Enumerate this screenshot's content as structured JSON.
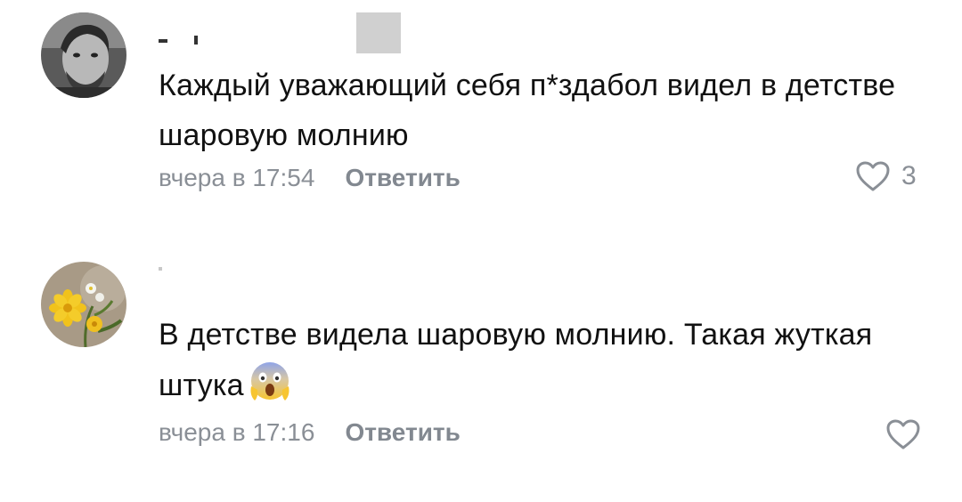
{
  "comments": [
    {
      "author": "",
      "text": "Каждый уважающий себя п*здабол видел в детстве шаровую молнию",
      "time": "вчера в 17:54",
      "reply_label": "Ответить",
      "likes": "3",
      "avatar": "man-portrait-avatar"
    },
    {
      "author": "",
      "text": "В детстве видела шаровую молнию. Такая жуткая штука",
      "emoji": "screaming-face-emoji",
      "time": "вчера в 17:16",
      "reply_label": "Ответить",
      "likes": "",
      "avatar": "yellow-flower-avatar"
    }
  ],
  "colors": {
    "text": "#111111",
    "meta": "#8a8f96",
    "background": "#ffffff"
  },
  "icons": [
    "heart-outline-icon"
  ]
}
